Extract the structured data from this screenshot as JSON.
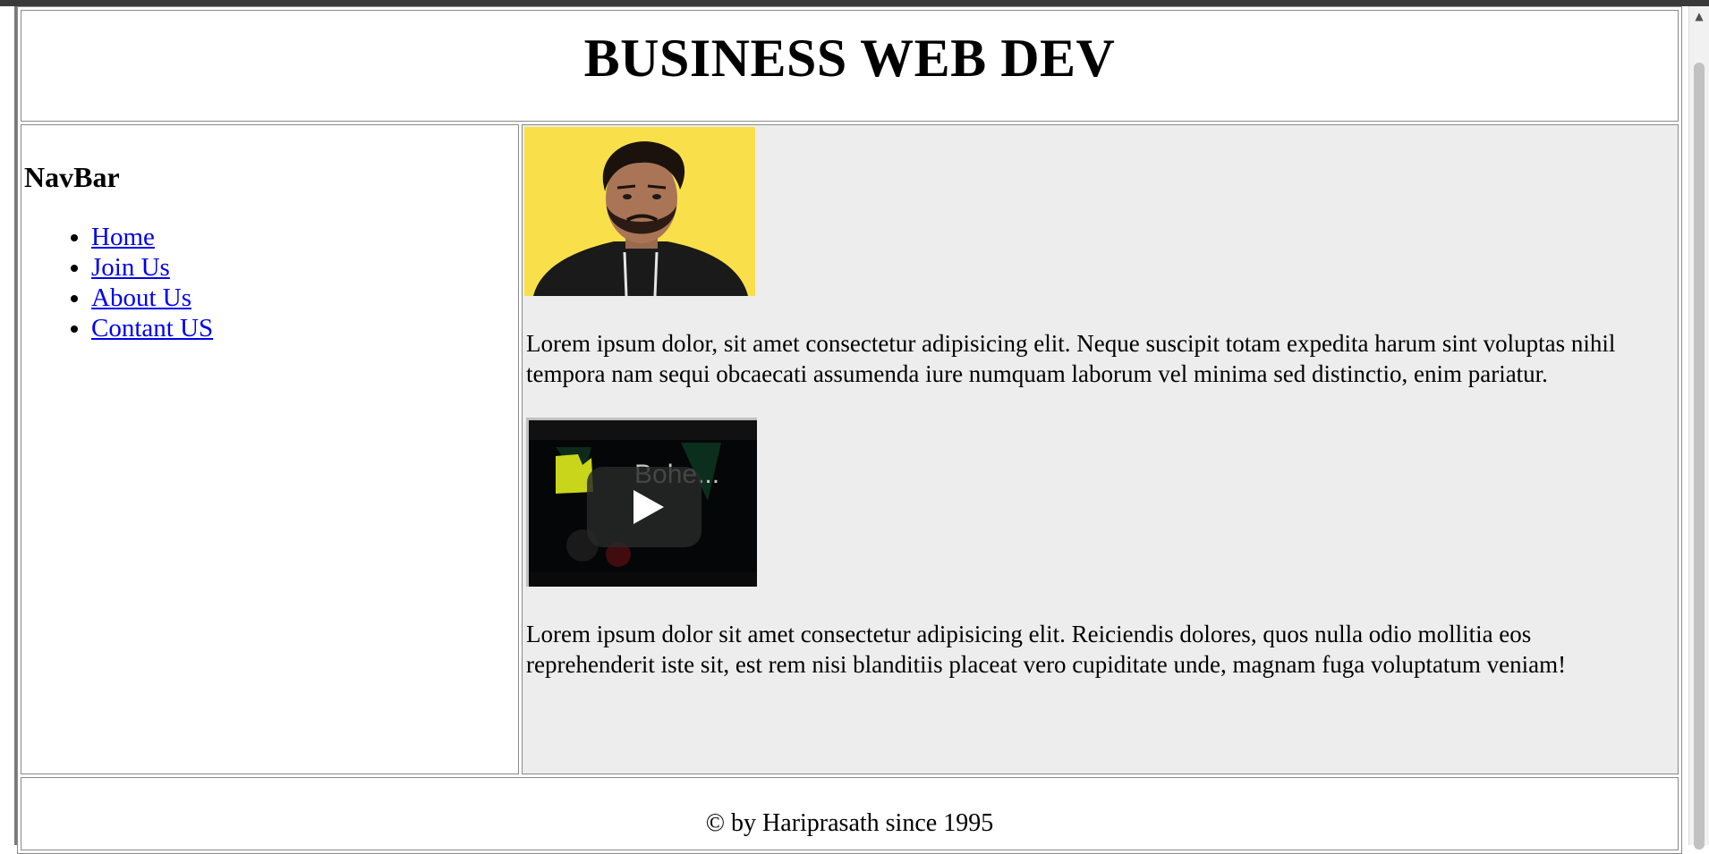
{
  "header": {
    "title": "BUSINESS WEB DEV"
  },
  "nav": {
    "heading": "NavBar",
    "links": [
      {
        "label": "Home"
      },
      {
        "label": "Join Us"
      },
      {
        "label": "About Us"
      },
      {
        "label": "Contant US"
      }
    ]
  },
  "main": {
    "image": {
      "icon": "profile-photo",
      "background": "#f9e04a"
    },
    "paragraph1": "Lorem ipsum dolor, sit amet consectetur adipisicing elit. Neque suscipit totam expedita harum sint voluptas nihil tempora nam sequi obcaecati assumenda iure numquam laborum vel minima sed distinctio, enim pariatur.",
    "video": {
      "title": "Bohe...",
      "play_icon": "play-icon"
    },
    "paragraph2": "Lorem ipsum dolor sit amet consectetur adipisicing elit. Reiciendis dolores, quos nulla odio mollitia eos reprehenderit iste sit, est rem nisi blanditiis placeat vero cupiditate unde, magnam fuga voluptatum veniam!"
  },
  "footer": {
    "text": "© by Hariprasath since 1995"
  },
  "colors": {
    "main_background": "#ededed",
    "link": "#0000ee",
    "border": "#8a8a8a"
  }
}
